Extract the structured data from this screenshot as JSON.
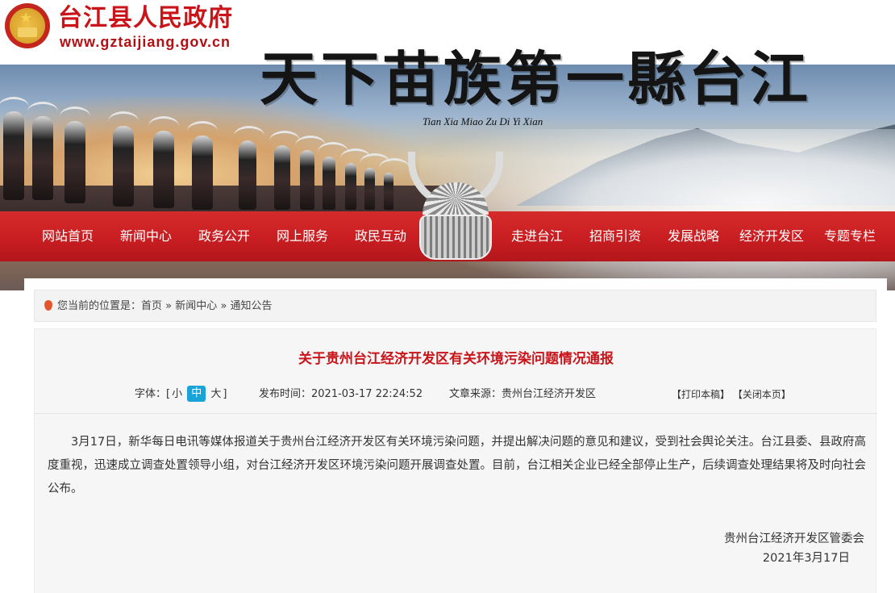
{
  "header": {
    "site_name": "台江县人民政府",
    "site_url": "www.gztaijiang.gov.cn",
    "slogan": "天下苗族第一縣台江",
    "slogan_pinyin": "Tian Xia Miao Zu Di Yi Xian",
    "emblem_icon": "national-emblem-icon",
    "brand_color": "#c9141a"
  },
  "nav": {
    "items_left": [
      "网站首页",
      "新闻中心",
      "政务公开",
      "网上服务",
      "政民互动"
    ],
    "items_right": [
      "走进台江",
      "招商引资",
      "发展战略",
      "经济开发区",
      "专题专栏"
    ],
    "bg_color": "#c81e22"
  },
  "breadcrumb": {
    "prefix": "您当前的位置是：",
    "items": [
      "首页",
      "新闻中心",
      "通知公告"
    ],
    "separator": "»",
    "icon": "location-pin-icon"
  },
  "article": {
    "title": "关于贵州台江经济开发区有关环境污染问题情况通报",
    "font_size_label": "字体：[",
    "font_sizes": [
      "小",
      "中",
      "大"
    ],
    "font_size_close": "]",
    "active_font_size": "中",
    "publish_time_label": "发布时间：",
    "publish_time": "2021-03-17 22:24:52",
    "source_label": "文章来源：",
    "source": "贵州台江经济开发区",
    "print_label": "【打印本稿】",
    "close_label": "【关闭本页】",
    "body": "3月17日，新华每日电讯等媒体报道关于贵州台江经济开发区有关环境污染问题，并提出解决问题的意见和建议，受到社会舆论关注。台江县委、县政府高度重视，迅速成立调查处置领导小组，对台江经济开发区环境污染问题开展调查处置。目前，台江相关企业已经全部停止生产，后续调查处理结果将及时向社会公布。",
    "signature": "贵州台江经济开发区管委会",
    "sign_date": "2021年3月17日",
    "title_color": "#c9141a",
    "active_font_color": "#1aa3d9"
  }
}
